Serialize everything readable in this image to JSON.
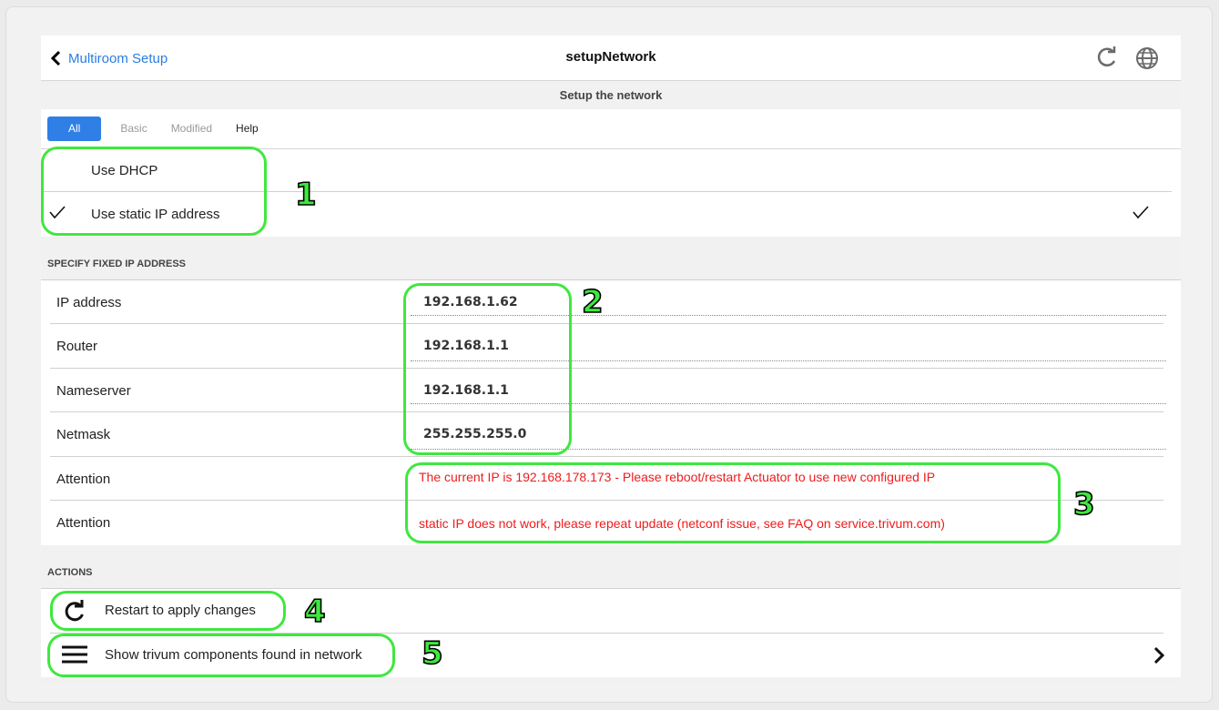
{
  "header": {
    "back_label": "Multiroom Setup",
    "title": "setupNetwork",
    "subtitle": "Setup the network"
  },
  "tabs": [
    {
      "label": "All",
      "active": true
    },
    {
      "label": "Basic",
      "active": false
    },
    {
      "label": "Modified",
      "active": false
    },
    {
      "label": "Help",
      "active": false
    }
  ],
  "mode_options": [
    {
      "label": "Use DHCP",
      "checked": false
    },
    {
      "label": "Use static IP address",
      "checked": true
    }
  ],
  "fixed_ip_section": {
    "title": "SPECIFY FIXED IP ADDRESS",
    "fields": [
      {
        "label": "IP address",
        "value": "192.168.1.62"
      },
      {
        "label": "Router",
        "value": "192.168.1.1"
      },
      {
        "label": "Nameserver",
        "value": "192.168.1.1"
      },
      {
        "label": "Netmask",
        "value": "255.255.255.0"
      }
    ],
    "attention": [
      {
        "label": "Attention",
        "text": "The current IP is 192.168.178.173 - Please reboot/restart Actuator to use new configured IP"
      },
      {
        "label": "Attention",
        "text": "static IP does not work, please repeat update (netconf issue, see FAQ on service.trivum.com)"
      }
    ]
  },
  "actions_section": {
    "title": "ACTIONS",
    "items": [
      {
        "label": "Restart to apply changes",
        "icon": "restart-icon"
      },
      {
        "label": "Show trivum components found in network",
        "icon": "menu-icon"
      }
    ]
  },
  "markers": [
    "1",
    "2",
    "3",
    "4",
    "5"
  ],
  "colors": {
    "accent": "#2f7fe6",
    "warning": "#ee1c1c",
    "highlight": "#3ee83e"
  }
}
